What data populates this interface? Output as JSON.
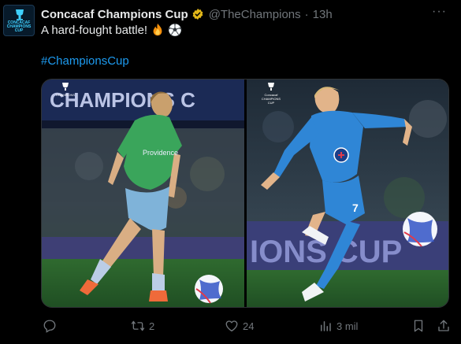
{
  "tweet": {
    "display_name": "Concacaf Champions Cup",
    "handle": "@TheChampions",
    "separator": "·",
    "time": "13h",
    "text": "A hard-fought battle!",
    "emojis": [
      "fire-emoji",
      "soccer-ball-emoji"
    ],
    "hashtag": "#ChampionsCup",
    "avatar_text": "CONCACAF\nCHAMPIONS\nCUP"
  },
  "media": {
    "left_photo": {
      "banner_text": "CHAMPIONS C",
      "jersey_sponsor": "Providence",
      "logo_text": "Concacaf\nCHAMPIONS\nCUP"
    },
    "right_photo": {
      "banner_text": "IONS CUP",
      "jersey_number": "7",
      "logo_text": "Concacaf\nCHAMPIONS\nCUP"
    }
  },
  "actions": {
    "reply_count": "",
    "retweet_count": "2",
    "like_count": "24",
    "views_count": "3 mil"
  },
  "colors": {
    "background": "#000000",
    "text": "#e7e9ea",
    "muted": "#71767b",
    "link": "#1d9bf0",
    "verified_gold": "#e2b719"
  }
}
